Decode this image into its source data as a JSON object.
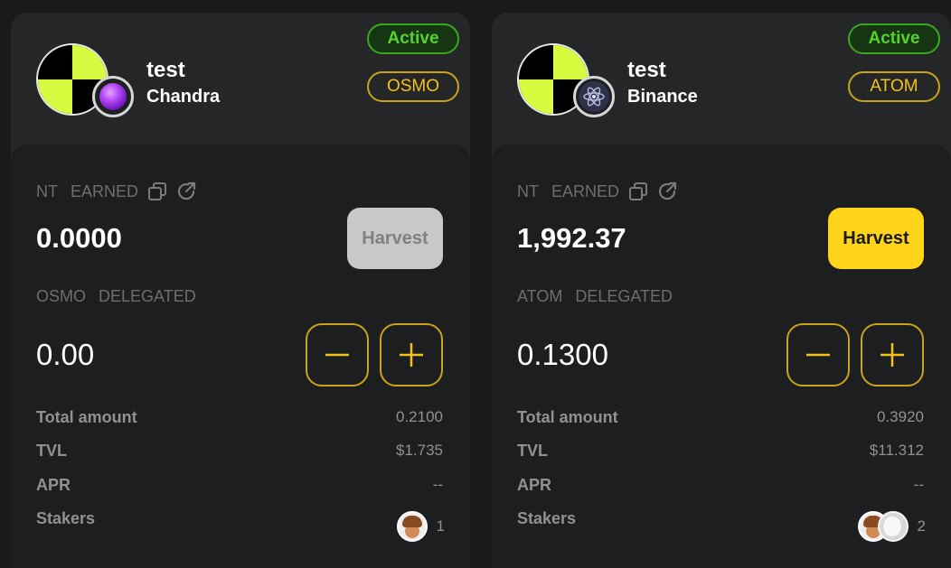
{
  "pools": [
    {
      "name": "test",
      "validator": "Chandra",
      "status": "Active",
      "token": "OSMO",
      "token_icon": "osmosis-icon",
      "avatar_colors": [
        "#000000",
        "#d7fb3f",
        "#d7fb3f",
        "#000000"
      ],
      "earned": {
        "label_prefix": "NT",
        "label": "EARNED",
        "value": "0.0000"
      },
      "harvest": {
        "label": "Harvest",
        "enabled": false
      },
      "delegated": {
        "label_prefix": "OSMO",
        "label": "DELEGATED",
        "value": "0.00"
      },
      "stats": [
        {
          "label": "Total amount",
          "value": "0.2100"
        },
        {
          "label": "TVL",
          "value": "$1.735"
        },
        {
          "label": "APR",
          "value": "--"
        }
      ],
      "stakers": {
        "label": "Stakers",
        "count": "1",
        "avatars": [
          "acorn-avatar"
        ]
      }
    },
    {
      "name": "test",
      "validator": "Binance",
      "status": "Active",
      "token": "ATOM",
      "token_icon": "cosmos-atom-icon",
      "avatar_colors": [
        "#000000",
        "#d7fb3f",
        "#d7fb3f",
        "#000000"
      ],
      "earned": {
        "label_prefix": "NT",
        "label": "EARNED",
        "value": "1,992.37"
      },
      "harvest": {
        "label": "Harvest",
        "enabled": true
      },
      "delegated": {
        "label_prefix": "ATOM",
        "label": "DELEGATED",
        "value": "0.1300"
      },
      "stats": [
        {
          "label": "Total amount",
          "value": "0.3920"
        },
        {
          "label": "TVL",
          "value": "$11.312"
        },
        {
          "label": "APR",
          "value": "--"
        }
      ],
      "stakers": {
        "label": "Stakers",
        "count": "2",
        "avatars": [
          "acorn-avatar",
          "moon-avatar"
        ]
      }
    }
  ],
  "colors": {
    "accent": "#fdd41a",
    "active_green": "#55d22b",
    "card_bg": "#252628",
    "panel_bg": "#1d1e20"
  }
}
